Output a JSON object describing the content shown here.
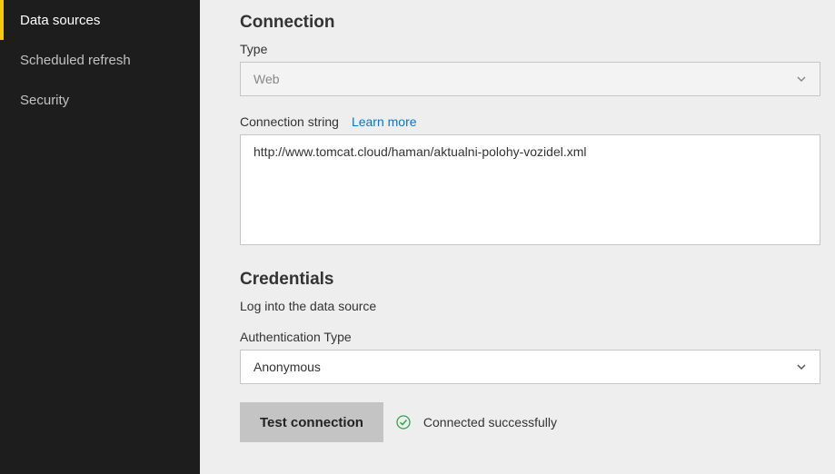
{
  "sidebar": {
    "items": [
      {
        "label": "Data sources",
        "active": true
      },
      {
        "label": "Scheduled refresh",
        "active": false
      },
      {
        "label": "Security",
        "active": false
      }
    ]
  },
  "connection": {
    "title": "Connection",
    "type_label": "Type",
    "type_value": "Web",
    "conn_string_label": "Connection string",
    "learn_more": "Learn more",
    "conn_string_value": "http://www.tomcat.cloud/haman/aktualni-polohy-vozidel.xml"
  },
  "credentials": {
    "title": "Credentials",
    "intro": "Log into the data source",
    "auth_type_label": "Authentication Type",
    "auth_type_value": "Anonymous",
    "test_button": "Test connection",
    "status_text": "Connected successfully"
  }
}
